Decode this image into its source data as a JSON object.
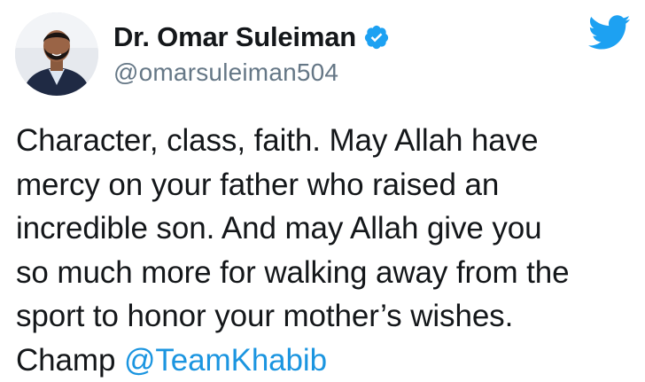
{
  "tweet": {
    "author": {
      "display_name": "Dr. Omar Suleiman",
      "handle": "@omarsuleiman504",
      "verified": true,
      "avatar_icon": "profile-photo",
      "verified_icon": "verified-badge-icon"
    },
    "brand_icon": "twitter-bird-icon",
    "lines": [
      "Character, class, faith. May Allah have",
      "mercy on your father who raised an",
      "incredible son. And may Allah give you",
      "so much more for walking away from the",
      "sport to honor your mother’s wishes."
    ],
    "last_line_prefix": "Champ ",
    "mention": "@TeamKhabib"
  },
  "colors": {
    "text": "#14171a",
    "secondary": "#657786",
    "accent": "#1da1f2",
    "link": "#1b95e0"
  }
}
